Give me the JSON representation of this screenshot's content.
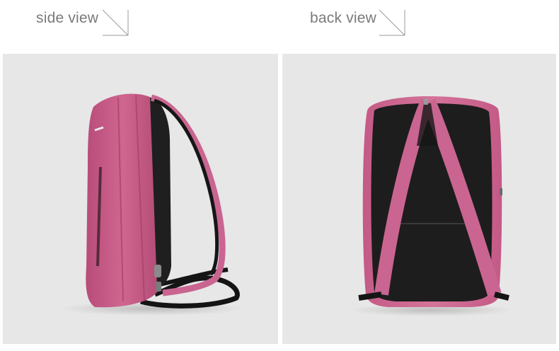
{
  "headings": {
    "side_view": "side view",
    "back_view": "back view"
  },
  "icons": {
    "side_heading_mark": "diagonal-corner-mark-icon",
    "back_heading_mark": "diagonal-corner-mark-icon"
  },
  "colors": {
    "fabric": "#c85a86",
    "fabric_dark": "#a8426c",
    "mesh": "#1e1e1e",
    "strap_black": "#111111",
    "panel_bg": "#e7e7e7",
    "label_text": "#7a7a7a"
  }
}
